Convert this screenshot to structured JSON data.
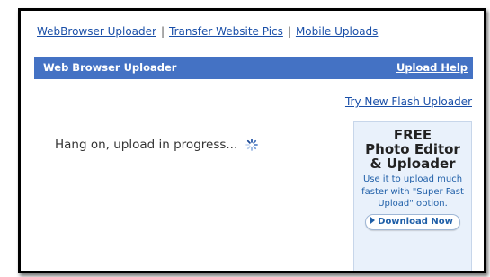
{
  "top_nav": {
    "links": [
      "WebBrowser Uploader",
      "Transfer Website Pics",
      "Mobile Uploads"
    ],
    "separator": "|"
  },
  "header": {
    "title": "Web Browser Uploader",
    "help_link": "Upload Help"
  },
  "flash_link": "Try New Flash Uploader",
  "status": {
    "message": "Hang on, upload in progress..."
  },
  "ad": {
    "free": "FREE",
    "title_line1": "Photo Editor",
    "title_line2": "& Uploader",
    "description": "Use it to upload much faster with \"Super Fast Upload\" option.",
    "button_label": "Download Now"
  },
  "colors": {
    "header_bar": "#4472c4",
    "link": "#1a4fa8",
    "ad_background": "#e9f1fb",
    "ad_text": "#1f5fa8"
  }
}
